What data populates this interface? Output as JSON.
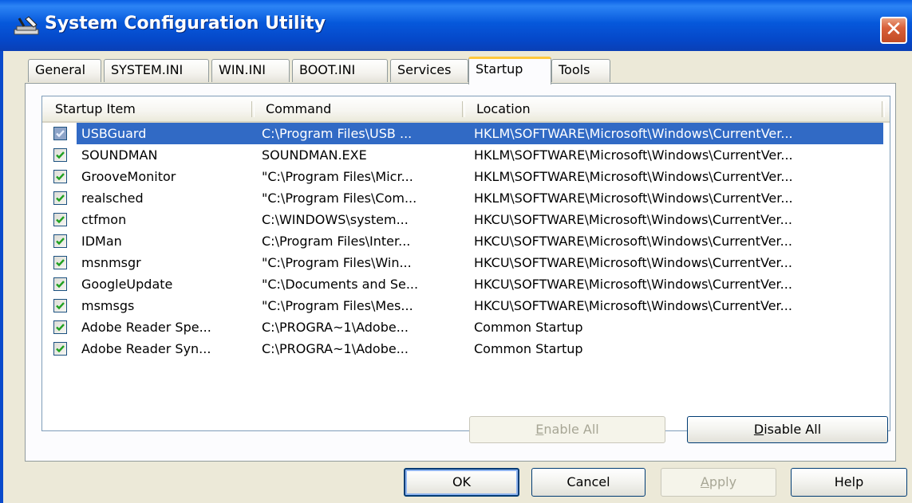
{
  "window": {
    "title": "System Configuration Utility",
    "close_glyph": "✕",
    "icon": "tools-icon"
  },
  "tabs": [
    {
      "label": "General"
    },
    {
      "label": "SYSTEM.INI"
    },
    {
      "label": "WIN.INI"
    },
    {
      "label": "BOOT.INI"
    },
    {
      "label": "Services"
    },
    {
      "label": "Startup",
      "active": true
    },
    {
      "label": "Tools"
    }
  ],
  "list": {
    "columns": [
      "Startup Item",
      "Command",
      "Location"
    ],
    "rows": [
      {
        "item": "USBGuard",
        "command": "C:\\Program Files\\USB ...",
        "location": "HKLM\\SOFTWARE\\Microsoft\\Windows\\CurrentVer...",
        "checked": true,
        "selected": true
      },
      {
        "item": "SOUNDMAN",
        "command": "SOUNDMAN.EXE",
        "location": "HKLM\\SOFTWARE\\Microsoft\\Windows\\CurrentVer...",
        "checked": true
      },
      {
        "item": "GrooveMonitor",
        "command": "\"C:\\Program Files\\Micr...",
        "location": "HKLM\\SOFTWARE\\Microsoft\\Windows\\CurrentVer...",
        "checked": true
      },
      {
        "item": "realsched",
        "command": "\"C:\\Program Files\\Com...",
        "location": "HKLM\\SOFTWARE\\Microsoft\\Windows\\CurrentVer...",
        "checked": true
      },
      {
        "item": "ctfmon",
        "command": "C:\\WINDOWS\\system...",
        "location": "HKCU\\SOFTWARE\\Microsoft\\Windows\\CurrentVer...",
        "checked": true
      },
      {
        "item": "IDMan",
        "command": "C:\\Program Files\\Inter...",
        "location": "HKCU\\SOFTWARE\\Microsoft\\Windows\\CurrentVer...",
        "checked": true
      },
      {
        "item": "msnmsgr",
        "command": "\"C:\\Program Files\\Win...",
        "location": "HKCU\\SOFTWARE\\Microsoft\\Windows\\CurrentVer...",
        "checked": true
      },
      {
        "item": "GoogleUpdate",
        "command": "\"C:\\Documents and Se...",
        "location": "HKCU\\SOFTWARE\\Microsoft\\Windows\\CurrentVer...",
        "checked": true
      },
      {
        "item": "msmsgs",
        "command": "\"C:\\Program Files\\Mes...",
        "location": "HKCU\\SOFTWARE\\Microsoft\\Windows\\CurrentVer...",
        "checked": true
      },
      {
        "item": "Adobe Reader Spe...",
        "command": "C:\\PROGRA~1\\Adobe...",
        "location": "Common Startup",
        "checked": true
      },
      {
        "item": "Adobe Reader Syn...",
        "command": "C:\\PROGRA~1\\Adobe...",
        "location": "Common Startup",
        "checked": true
      }
    ]
  },
  "panel_buttons": {
    "enable_all": {
      "mnemonic": "E",
      "rest": "nable All",
      "enabled": false
    },
    "disable_all": {
      "mnemonic": "D",
      "rest": "isable All",
      "enabled": true
    }
  },
  "dialog_buttons": {
    "ok": "OK",
    "cancel": "Cancel",
    "apply": {
      "mnemonic": "A",
      "rest": "pply",
      "enabled": false
    },
    "help": "Help"
  },
  "colors": {
    "title_bar": "#0654D8",
    "selection": "#316AC5",
    "active_tab_accent": "#FFC83C",
    "face": "#ECE9D8"
  }
}
